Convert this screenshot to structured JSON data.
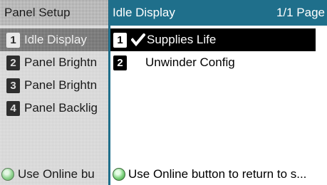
{
  "colors": {
    "accent": "#1f6f8b",
    "selected_row": "#000000",
    "online_button": "#4caf50"
  },
  "left_panel": {
    "title": "Panel Setup",
    "items": [
      {
        "number": "1",
        "label": "Idle Display",
        "selected": true
      },
      {
        "number": "2",
        "label": "Panel Brightn",
        "selected": false
      },
      {
        "number": "3",
        "label": "Panel Brightn",
        "selected": false
      },
      {
        "number": "4",
        "label": "Panel Backlig",
        "selected": false
      }
    ],
    "footer": {
      "icon": "online-button-icon",
      "text": "Use Online bu"
    }
  },
  "right_panel": {
    "title": "Idle Display",
    "page_indicator": "1/1 Page",
    "options": [
      {
        "number": "1",
        "label": "Supplies Life",
        "checked": true,
        "selected": true,
        "icon": "checkmark-icon"
      },
      {
        "number": "2",
        "label": "Unwinder Config",
        "checked": false,
        "selected": false
      }
    ],
    "footer": {
      "icon": "online-button-icon",
      "text": "Use Online button to return to s..."
    }
  }
}
